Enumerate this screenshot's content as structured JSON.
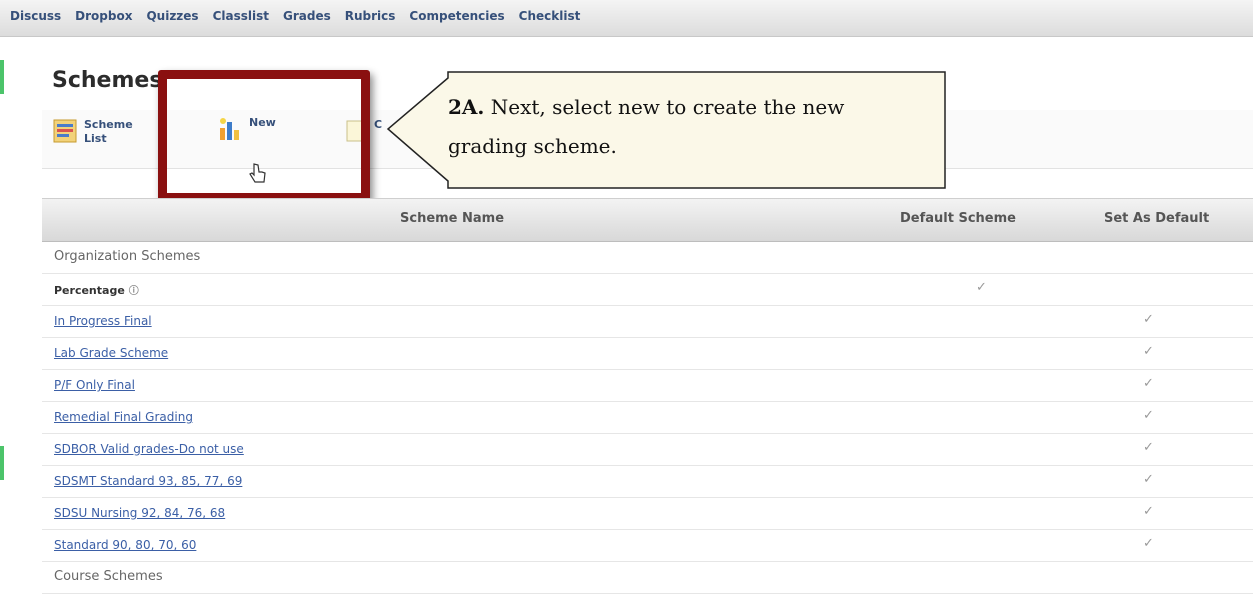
{
  "nav": {
    "items": [
      "Discuss",
      "Dropbox",
      "Quizzes",
      "Classlist",
      "Grades",
      "Rubrics",
      "Competencies",
      "Checklist"
    ]
  },
  "page": {
    "title": "Schemes"
  },
  "toolbar": {
    "scheme_list_label": "Scheme List",
    "new_label": "New",
    "third_label": "C"
  },
  "callout": {
    "label": "2A.",
    "text": "Next, select new to create the new grading scheme."
  },
  "table": {
    "headers": {
      "name": "Scheme Name",
      "default": "Default Scheme",
      "set": "Set As Default"
    },
    "section_org": "Organization Schemes",
    "rows": [
      {
        "name": "Percentage",
        "type": "plain",
        "default": true,
        "set": false
      },
      {
        "name": "In Progress Final",
        "type": "link",
        "default": false,
        "set": true
      },
      {
        "name": "Lab Grade Scheme",
        "type": "link",
        "default": false,
        "set": true
      },
      {
        "name": "P/F Only Final",
        "type": "link",
        "default": false,
        "set": true
      },
      {
        "name": "Remedial Final Grading",
        "type": "link",
        "default": false,
        "set": true
      },
      {
        "name": "SDBOR Valid grades-Do not use",
        "type": "link",
        "default": false,
        "set": true
      },
      {
        "name": "SDSMT Standard 93, 85, 77, 69",
        "type": "link",
        "default": false,
        "set": true
      },
      {
        "name": "SDSU Nursing 92, 84, 76, 68",
        "type": "link",
        "default": false,
        "set": true
      },
      {
        "name": "Standard 90, 80, 70, 60",
        "type": "link",
        "default": false,
        "set": true
      }
    ],
    "section_course": "Course Schemes"
  },
  "checkmark": "✓",
  "info_symbol": "ⓘ",
  "colors": {
    "highlight": "#8a1010",
    "link": "#3b5fa6",
    "accent": "#4cc46a"
  }
}
